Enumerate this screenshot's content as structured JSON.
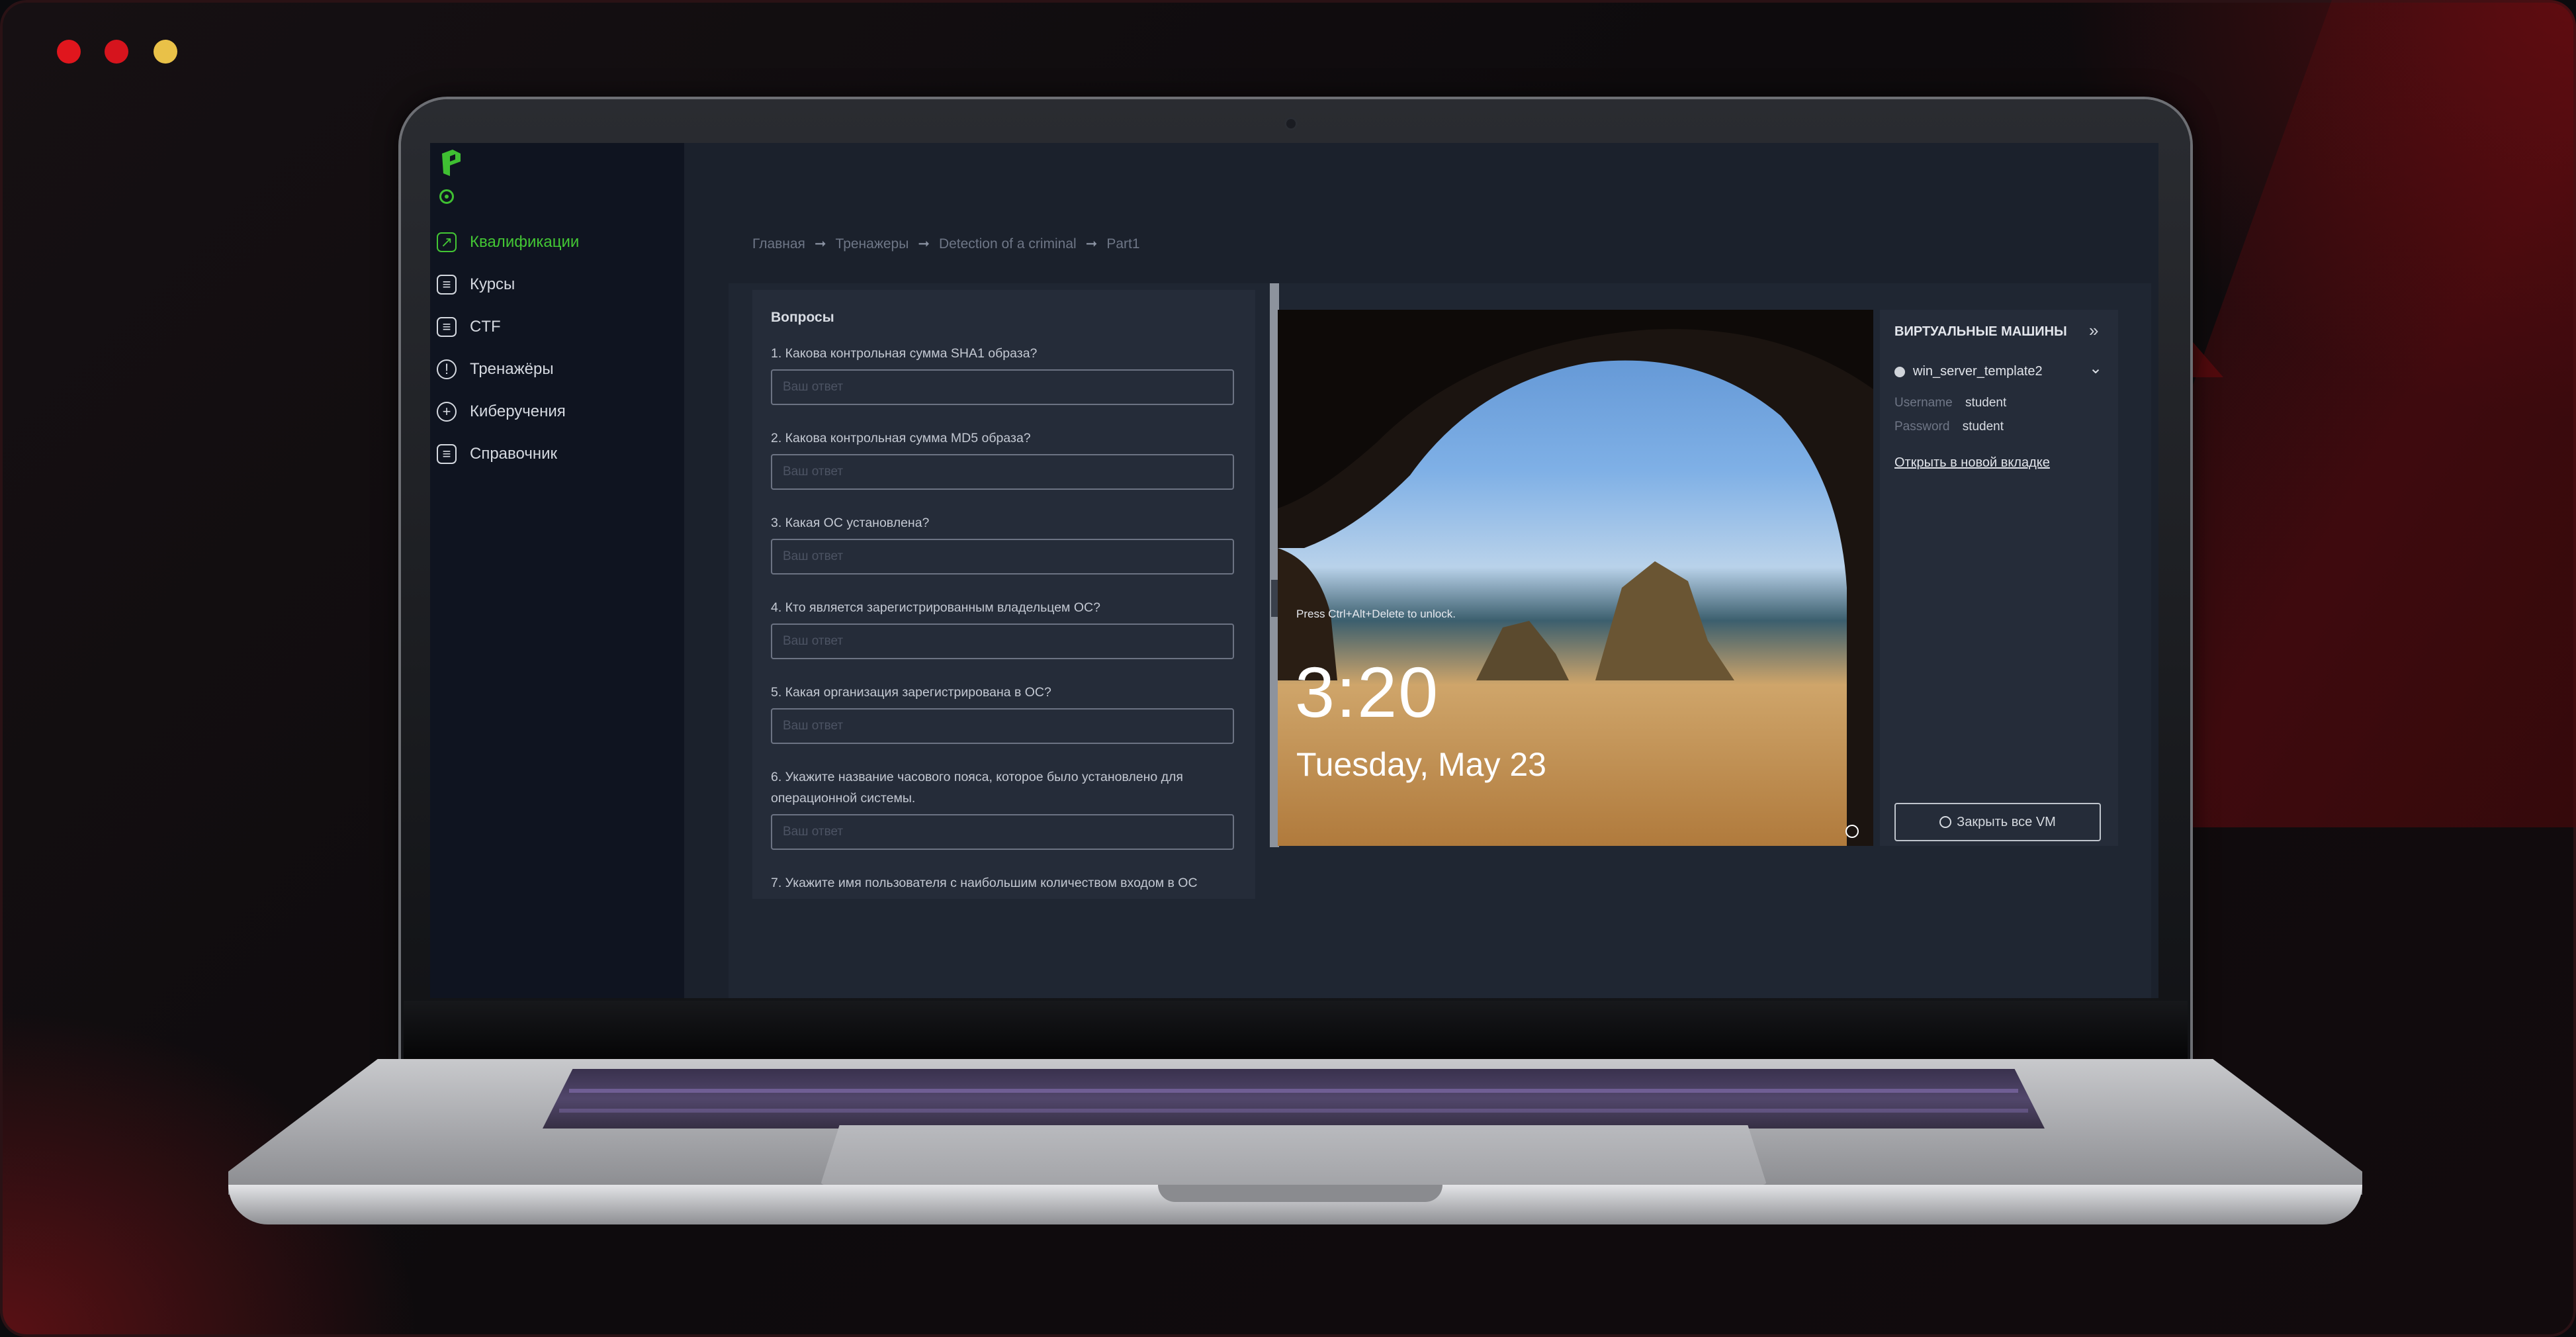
{
  "sidebar": {
    "items": [
      {
        "label": "Квалификации",
        "icon": "chart-icon",
        "active": true
      },
      {
        "label": "Курсы",
        "icon": "list-icon"
      },
      {
        "label": "CTF",
        "icon": "flag-icon"
      },
      {
        "label": "Тренажёры",
        "icon": "shield-icon"
      },
      {
        "label": "Киберучения",
        "icon": "target-icon"
      },
      {
        "label": "Справочник",
        "icon": "book-icon"
      }
    ]
  },
  "breadcrumb": [
    "Главная",
    "Тренажеры",
    "Detection of a criminal",
    "Part1"
  ],
  "questions": {
    "title": "Вопросы",
    "placeholder": "Ваш ответ",
    "items": [
      "1. Какова контрольная сумма SHA1 образа?",
      "2. Какова контрольная сумма MD5 образа?",
      "3. Какая ОС установлена?",
      "4. Кто является зарегистрированным владельцем ОС?",
      "5. Какая организация зарегистрирована в ОС?",
      "6. Укажите название часового пояса, которое было установлено для операционной системы.",
      "7. Укажите имя пользователя с наибольшим количеством входом в ОС"
    ]
  },
  "vm_screen": {
    "hint": "Press Ctrl+Alt+Delete to unlock.",
    "time": "3:20",
    "date": "Tuesday, May 23"
  },
  "vm_panel": {
    "title": "ВИРТУАЛЬНЫЕ МАШИНЫ",
    "vm_name": "win_server_template2",
    "username_label": "Username",
    "username": "student",
    "password_label": "Password",
    "password": "student",
    "open_link": "Открыть в новой вкладке",
    "close_all": "Закрыть все VM"
  },
  "colors": {
    "accent": "#43c634",
    "sidebar_bg": "#0f1420",
    "main_bg": "#1b212c"
  }
}
